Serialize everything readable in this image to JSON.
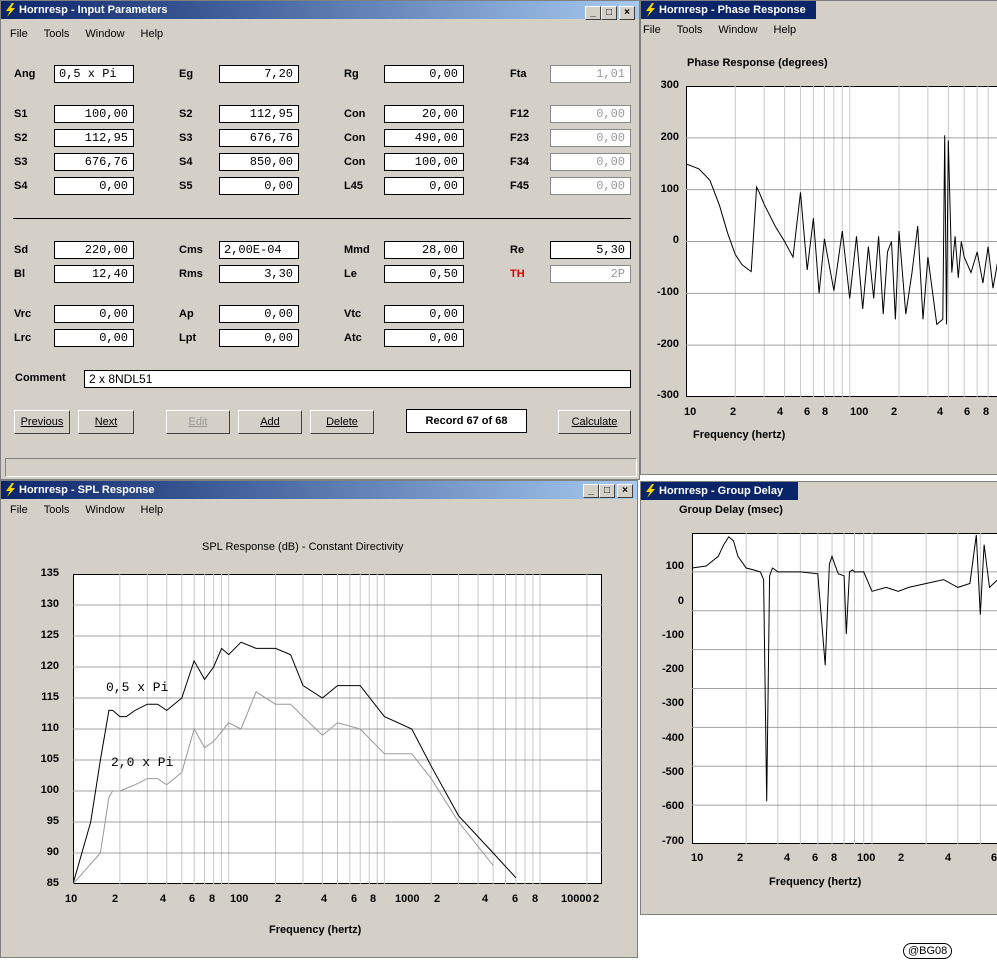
{
  "menus": [
    "File",
    "Tools",
    "Window",
    "Help"
  ],
  "input_window": {
    "title": "Hornresp - Input Parameters",
    "rows": [
      [
        {
          "l": "Ang",
          "v": "0,5 x Pi",
          "left": true
        },
        {
          "l": "Eg",
          "v": "7,20"
        },
        {
          "l": "Rg",
          "v": "0,00"
        },
        {
          "l": "Fta",
          "v": "1,01",
          "grey": true
        }
      ],
      [
        {
          "l": "S1",
          "v": "100,00"
        },
        {
          "l": "S2",
          "v": "112,95"
        },
        {
          "l": "Con",
          "v": "20,00"
        },
        {
          "l": "F12",
          "v": "0,00",
          "grey": true
        }
      ],
      [
        {
          "l": "S2",
          "v": "112,95"
        },
        {
          "l": "S3",
          "v": "676,76"
        },
        {
          "l": "Con",
          "v": "490,00"
        },
        {
          "l": "F23",
          "v": "0,00",
          "grey": true
        }
      ],
      [
        {
          "l": "S3",
          "v": "676,76"
        },
        {
          "l": "S4",
          "v": "850,00"
        },
        {
          "l": "Con",
          "v": "100,00"
        },
        {
          "l": "F34",
          "v": "0,00",
          "grey": true
        }
      ],
      [
        {
          "l": "S4",
          "v": "0,00"
        },
        {
          "l": "S5",
          "v": "0,00"
        },
        {
          "l": "L45",
          "v": "0,00"
        },
        {
          "l": "F45",
          "v": "0,00",
          "grey": true
        }
      ],
      [
        {
          "l": "Sd",
          "v": "220,00"
        },
        {
          "l": "Cms",
          "v": "2,00E-04",
          "left": true
        },
        {
          "l": "Mmd",
          "v": "28,00"
        },
        {
          "l": "Re",
          "v": "5,30"
        }
      ],
      [
        {
          "l": "Bl",
          "v": "12,40"
        },
        {
          "l": "Rms",
          "v": "3,30"
        },
        {
          "l": "Le",
          "v": "0,50"
        },
        {
          "l": "TH",
          "v": "2P",
          "grey": true,
          "red": true
        }
      ],
      [
        {
          "l": "Vrc",
          "v": "0,00"
        },
        {
          "l": "Ap",
          "v": "0,00"
        },
        {
          "l": "Vtc",
          "v": "0,00"
        }
      ],
      [
        {
          "l": "Lrc",
          "v": "0,00"
        },
        {
          "l": "Lpt",
          "v": "0,00"
        },
        {
          "l": "Atc",
          "v": "0,00"
        }
      ]
    ],
    "comment_label": "Comment",
    "comment_value": "2 x 8NDL51",
    "buttons": {
      "previous": "Previous",
      "next": "Next",
      "edit": "Edit",
      "add": "Add",
      "delete": "Delete",
      "calculate": "Calculate"
    },
    "record": "Record 67 of 68"
  },
  "phase_window": {
    "title": "Hornresp - Phase Response",
    "chart_title": "Phase Response (degrees)",
    "xlabel": "Frequency (hertz)",
    "yticks": [
      "300",
      "200",
      "100",
      "0",
      "-100",
      "-200",
      "-300"
    ],
    "xticks": [
      "10",
      "2",
      "4",
      "6",
      "8",
      "100",
      "2",
      "4",
      "6",
      "8"
    ]
  },
  "spl_window": {
    "title": "Hornresp - SPL Response",
    "chart_title": "SPL Response (dB) - Constant Directivity",
    "xlabel": "Frequency (hertz)",
    "yticks": [
      "135",
      "130",
      "125",
      "120",
      "115",
      "110",
      "105",
      "100",
      "95",
      "90",
      "85"
    ],
    "xticks": [
      "10",
      "2",
      "4",
      "6",
      "8",
      "100",
      "2",
      "4",
      "6",
      "8",
      "1000",
      "2",
      "4",
      "6",
      "8",
      "10000",
      "2"
    ],
    "series_labels": [
      "0,5 x Pi",
      "2,0 x Pi"
    ]
  },
  "gd_window": {
    "title": "Hornresp - Group Delay",
    "chart_title": "Group Delay (msec)",
    "xlabel": "Frequency (hertz)",
    "yticks": [
      "100",
      "0",
      "-100",
      "-200",
      "-300",
      "-400",
      "-500",
      "-600",
      "-700"
    ],
    "xticks": [
      "10",
      "2",
      "4",
      "6",
      "8",
      "100",
      "2",
      "4",
      "6"
    ]
  },
  "stamp": "@BG08",
  "chart_data": [
    {
      "type": "line",
      "title": "Phase Response (degrees)",
      "xlabel": "Frequency (hertz)",
      "xscale": "log",
      "ylim": [
        -300,
        300
      ],
      "series": [
        {
          "x": [
            10,
            12,
            14,
            16,
            18,
            20,
            22,
            25,
            27,
            28,
            30,
            35,
            40,
            45,
            50,
            55,
            60,
            65,
            70,
            80,
            90,
            100,
            110,
            120,
            130,
            140,
            150,
            160,
            170,
            180,
            190,
            200,
            220,
            240,
            260,
            280,
            300,
            340,
            370,
            380,
            390,
            400,
            420,
            440,
            460,
            480,
            500,
            550,
            600,
            650,
            700,
            750,
            800,
            850,
            900
          ],
          "y": [
            150,
            140,
            118,
            70,
            15,
            -25,
            -45,
            -58,
            105,
            95,
            72,
            30,
            0,
            -30,
            95,
            -55,
            45,
            -100,
            5,
            -95,
            20,
            -110,
            10,
            -130,
            -10,
            -110,
            10,
            -140,
            -20,
            0,
            -150,
            20,
            -140,
            -60,
            30,
            -150,
            -30,
            -160,
            -150,
            205,
            -160,
            195,
            -60,
            10,
            -70,
            0,
            -30,
            -60,
            -20,
            -80,
            -10,
            -90,
            -40,
            -95,
            -120
          ]
        }
      ]
    },
    {
      "type": "line",
      "title": "SPL Response (dB) - Constant Directivity",
      "xlabel": "Frequency (hertz)",
      "xscale": "log",
      "ylim": [
        85,
        135
      ],
      "series": [
        {
          "name": "0,5 x Pi",
          "x": [
            10,
            13,
            15,
            17,
            18,
            20,
            22,
            25,
            30,
            35,
            40,
            50,
            60,
            70,
            80,
            90,
            100,
            120,
            150,
            200,
            250,
            300,
            400,
            500,
            700,
            1000,
            1500,
            2000,
            3000,
            5000,
            7000
          ],
          "y": [
            85,
            95,
            105,
            113,
            113,
            112,
            112,
            113,
            114,
            114,
            113,
            115,
            121,
            118,
            120,
            123,
            122,
            124,
            123,
            123,
            122,
            117,
            115,
            117,
            117,
            112,
            110,
            104,
            96,
            90,
            86
          ]
        },
        {
          "name": "2,0 x Pi",
          "x": [
            10,
            15,
            17,
            18,
            20,
            25,
            30,
            35,
            40,
            50,
            60,
            70,
            80,
            100,
            120,
            150,
            200,
            250,
            300,
            400,
            500,
            700,
            1000,
            1500,
            2000,
            3000,
            5000
          ],
          "y": [
            85,
            90,
            99,
            100,
            100,
            101,
            102,
            102,
            101,
            103,
            110,
            107,
            108,
            111,
            110,
            116,
            114,
            114,
            112,
            109,
            111,
            110,
            106,
            106,
            102,
            95,
            88
          ]
        }
      ]
    },
    {
      "type": "line",
      "title": "Group Delay (msec)",
      "xlabel": "Frequency (hertz)",
      "xscale": "log",
      "ylim": [
        -700,
        100
      ],
      "series": [
        {
          "x": [
            10,
            12,
            14,
            15,
            16,
            17,
            18,
            20,
            22,
            24,
            25,
            26,
            27,
            28,
            29,
            30,
            35,
            40,
            50,
            55,
            58,
            60,
            62,
            65,
            70,
            72,
            75,
            78,
            80,
            85,
            90,
            100,
            120,
            140,
            160,
            200,
            250,
            300,
            350,
            380,
            400,
            420,
            450,
            500,
            600,
            700,
            800,
            900
          ],
          "y": [
            10,
            15,
            40,
            70,
            90,
            80,
            40,
            10,
            5,
            0,
            -20,
            -590,
            -10,
            10,
            5,
            0,
            0,
            0,
            -5,
            -240,
            20,
            40,
            20,
            -5,
            -10,
            -160,
            0,
            5,
            0,
            0,
            0,
            -50,
            -40,
            -50,
            -40,
            -30,
            -20,
            -40,
            -30,
            95,
            -110,
            70,
            -40,
            -20,
            -5,
            -5,
            0,
            0
          ]
        }
      ]
    }
  ]
}
